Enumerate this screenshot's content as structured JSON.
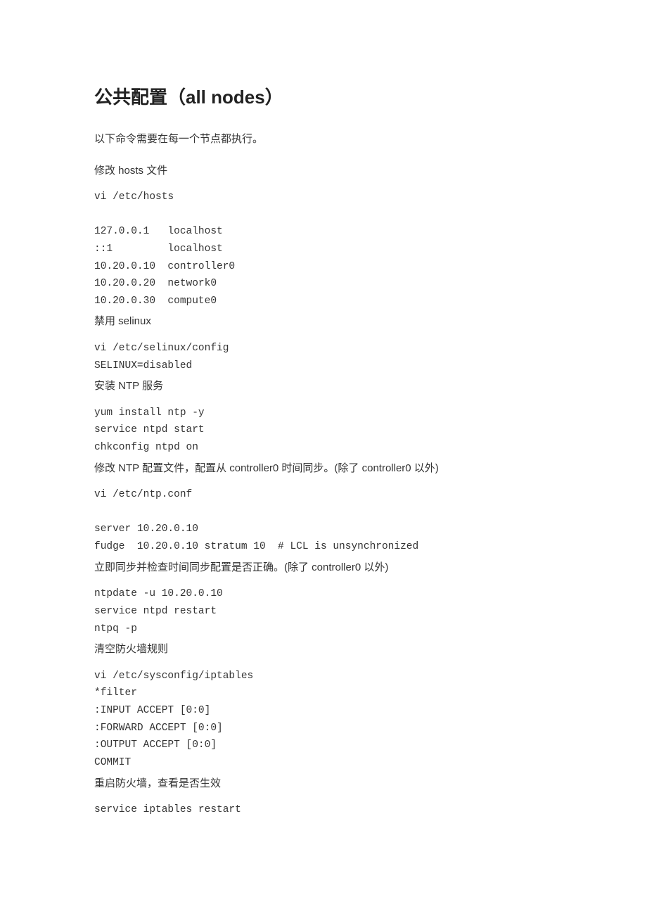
{
  "heading": "公共配置（all nodes）",
  "p_intro": "以下命令需要在每一个节点都执行。",
  "p_hosts": "修改 hosts  文件",
  "code_hosts": "vi /etc/hosts\n\n127.0.0.1   localhost\n::1         localhost\n10.20.0.10  controller0\n10.20.0.20  network0\n10.20.0.30  compute0",
  "p_selinux": "禁用  selinux",
  "code_selinux": "vi /etc/selinux/config\nSELINUX=disabled",
  "p_ntp_install": "安装 NTP  服务",
  "code_ntp_install": "yum install ntp -y\nservice ntpd start\nchkconfig ntpd on",
  "p_ntp_conf": "修改 NTP 配置文件，配置从 controller0 时间同步。(除了 controller0 以外)",
  "code_ntp_conf": "vi /etc/ntp.conf\n\nserver 10.20.0.10\nfudge  10.20.0.10 stratum 10  # LCL is unsynchronized",
  "p_ntp_sync": "立即同步并检查时间同步配置是否正确。(除了 controller0 以外)",
  "code_ntp_sync": "ntpdate -u 10.20.0.10\nservice ntpd restart\nntpq -p",
  "p_iptables_clear": "清空防火墙规则",
  "code_iptables": "vi /etc/sysconfig/iptables\n*filter\n:INPUT ACCEPT [0:0]\n:FORWARD ACCEPT [0:0]\n:OUTPUT ACCEPT [0:0]\nCOMMIT",
  "p_iptables_restart": "重启防火墙，查看是否生效",
  "code_iptables_restart": "service iptables restart"
}
